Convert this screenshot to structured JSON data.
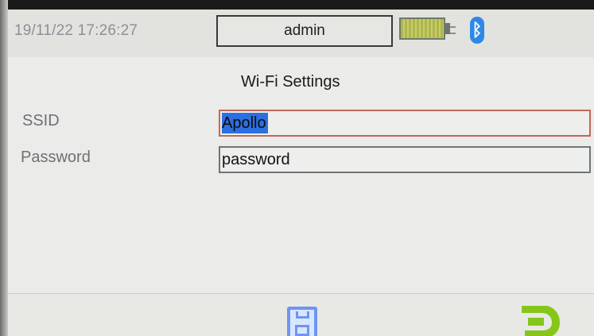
{
  "status_bar": {
    "datetime": "19/11/22 17:26:27",
    "user": "admin"
  },
  "page": {
    "title": "Wi-Fi Settings"
  },
  "fields": {
    "ssid": {
      "label": "SSID",
      "value": "Apollo"
    },
    "password": {
      "label": "Password",
      "value": "password"
    }
  },
  "icons": {
    "battery": "battery-icon",
    "bluetooth": "bluetooth-icon",
    "save": "save-icon",
    "back": "back-icon"
  },
  "colors": {
    "selection": "#2b6fe0",
    "bluetooth": "#2f88e6",
    "save_icon": "#6f95f2",
    "back_icon": "#86c61a",
    "focused_field_border": "#bd6a56"
  }
}
